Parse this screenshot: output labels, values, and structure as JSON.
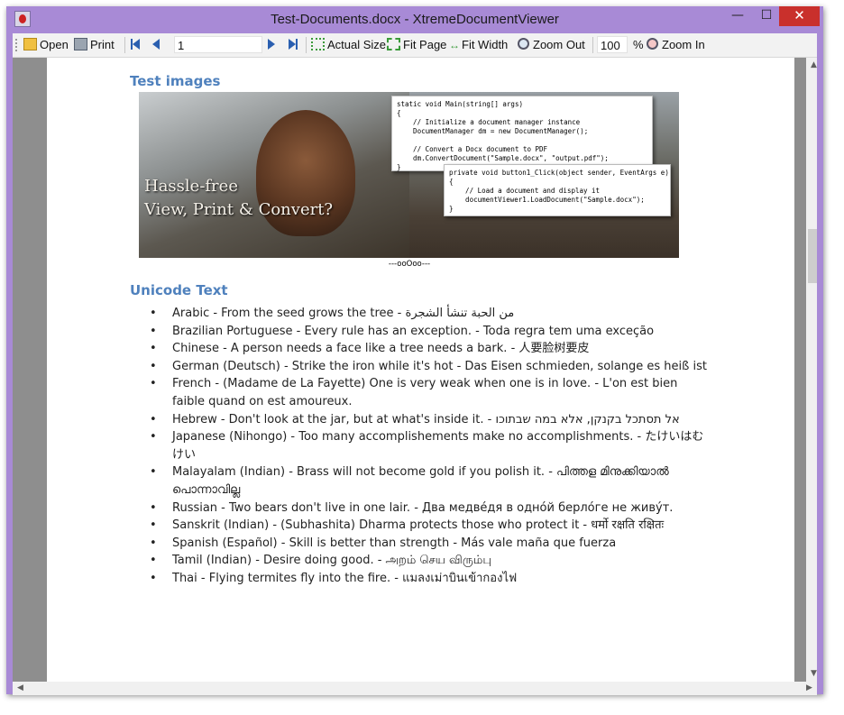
{
  "window": {
    "title": "Test-Documents.docx - XtremeDocumentViewer",
    "controls": {
      "minimize": "—",
      "maximize": "☐",
      "close": "✕"
    }
  },
  "toolbar": {
    "open_label": "Open",
    "print_label": "Print",
    "page_value": "1",
    "actual_size_label": "Actual Size",
    "fit_page_label": "Fit Page",
    "fit_width_label": "Fit Width",
    "zoom_out_label": "Zoom Out",
    "zoom_value": "100",
    "zoom_unit": "%",
    "zoom_in_label": "Zoom In"
  },
  "document": {
    "heading_images": "Test images",
    "banner": {
      "line1": "Hassle-free",
      "line2": "View, Print & Convert?"
    },
    "code1": "static void Main(string[] args)\n{\n    // Initialize a document manager instance\n    DocumentManager dm = new DocumentManager();\n\n    // Convert a Docx document to PDF\n    dm.ConvertDocument(\"Sample.docx\", \"output.pdf\");\n}",
    "code2": "private void button1_Click(object sender, EventArgs e)\n{\n    // Load a document and display it\n    documentViewer1.LoadDocument(\"Sample.docx\");\n}",
    "caption": "---ooOoo---",
    "heading_unicode": "Unicode Text",
    "items": [
      "Arabic - From the seed grows the tree - من الحبة تنشأ الشجرة",
      "Brazilian Portuguese - Every rule has an exception. - Toda regra tem uma exceção",
      "Chinese - A person needs a face like a tree needs a bark. - 人要脸树要皮",
      "German (Deutsch) - Strike the iron while it's hot - Das Eisen schmieden, solange es heiß ist",
      "French - (Madame de La Fayette) One is very weak when one is in love. - L'on est bien faible quand on est amoureux.",
      "Hebrew - Don't look at the jar, but at what's inside it. - אל תסתכל בקנקן, אלא במה שבתוכו",
      "Japanese (Nihongo) - Too many accomplishements make no accomplishments. - たけいはむけい",
      "Malayalam (Indian) - Brass will not become gold if you polish it. - പിത്തള മിനുക്കിയാല്‍ പൊന്നാവില്ല",
      "Russian - Two bears don't live in one lair. - Два медве́дя в одно́й берло́ге не живу́т.",
      "Sanskrit (Indian) - (Subhashita) Dharma protects those who protect it - धर्मो रक्षति रक्षितः",
      "Spanish (Español) - Skill is better than strength - Más vale maña que fuerza",
      "Tamil (Indian) - Desire doing good. - அறம் செய விரும்பு",
      "Thai - Flying termites fly into the fire. - แมลงเม่าบินเข้ากองไฟ"
    ]
  }
}
